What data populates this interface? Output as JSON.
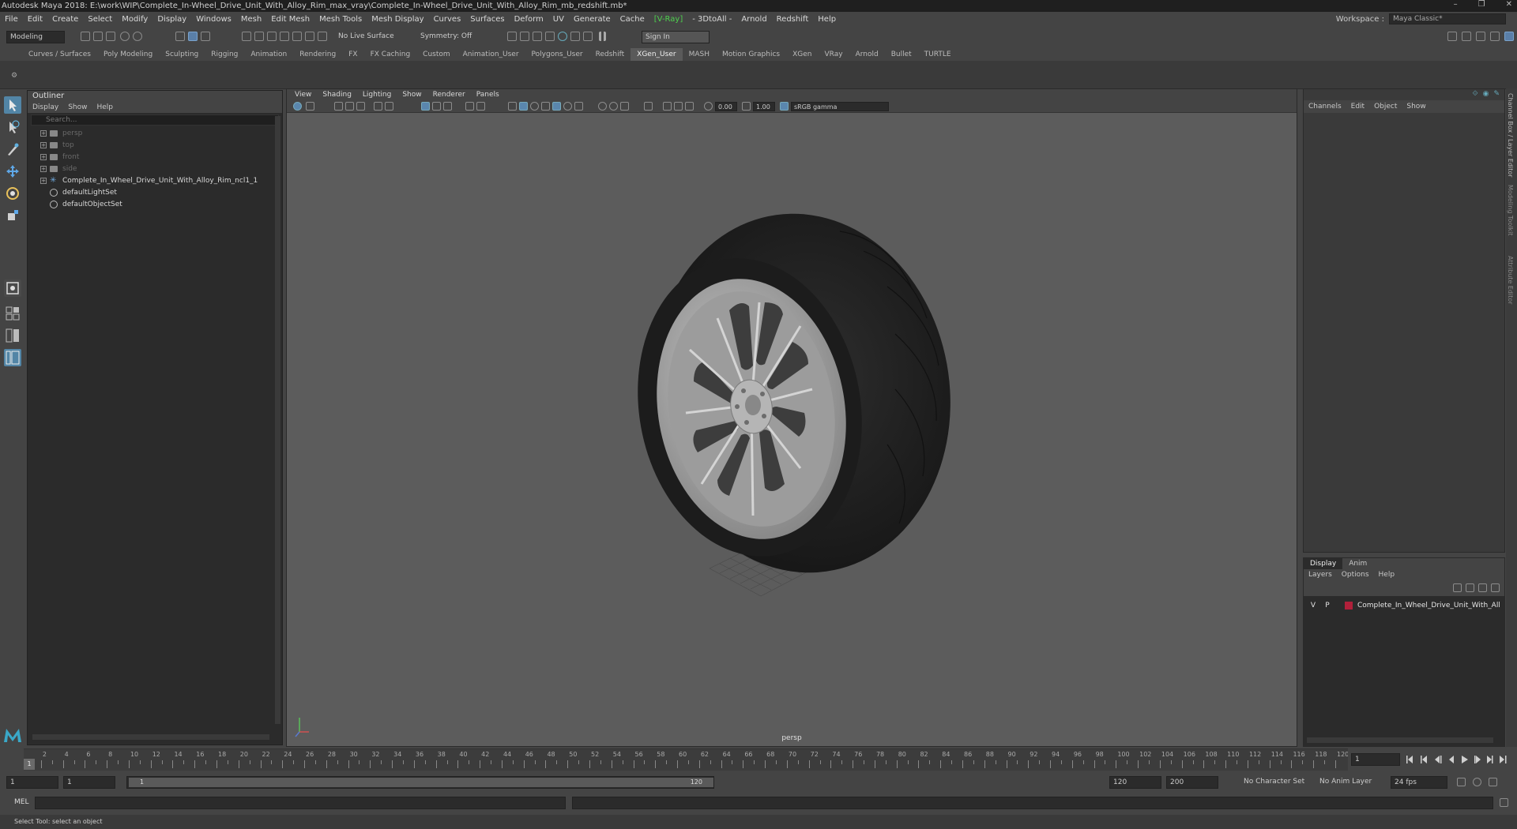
{
  "window": {
    "title": "Autodesk Maya 2018: E:\\work\\WIP\\Complete_In-Wheel_Drive_Unit_With_Alloy_Rim_max_vray\\Complete_In-Wheel_Drive_Unit_With_Alloy_Rim_mb_redshift.mb*",
    "minimize": "–",
    "restore": "❐",
    "close": "✕"
  },
  "menubar": {
    "items": [
      "File",
      "Edit",
      "Create",
      "Select",
      "Modify",
      "Display",
      "Windows",
      "Mesh",
      "Edit Mesh",
      "Mesh Tools",
      "Mesh Display",
      "Curves",
      "Surfaces",
      "Deform",
      "UV",
      "Generate",
      "Cache",
      "[V-Ray]",
      "- 3DtoAll -",
      "Arnold",
      "Redshift",
      "Help"
    ],
    "workspace_label": "Workspace :",
    "workspace_value": "Maya Classic*"
  },
  "statusline": {
    "mode": "Modeling",
    "live_surface": "No Live Surface",
    "symmetry": "Symmetry: Off",
    "sign_in": "Sign In"
  },
  "shelf": {
    "tabs": [
      "Curves / Surfaces",
      "Poly Modeling",
      "Sculpting",
      "Rigging",
      "Animation",
      "Rendering",
      "FX",
      "FX Caching",
      "Custom",
      "Animation_User",
      "Polygons_User",
      "Redshift",
      "XGen_User",
      "MASH",
      "Motion Graphics",
      "XGen",
      "VRay",
      "Arnold",
      "Bullet",
      "TURTLE"
    ],
    "active_tab": "XGen_User"
  },
  "outliner": {
    "title": "Outliner",
    "menu": [
      "Display",
      "Show",
      "Help"
    ],
    "search_placeholder": "Search...",
    "items": [
      {
        "label": "persp",
        "dim": true,
        "icon": "camera-icon"
      },
      {
        "label": "top",
        "dim": true,
        "icon": "camera-icon"
      },
      {
        "label": "front",
        "dim": true,
        "icon": "camera-icon"
      },
      {
        "label": "side",
        "dim": true,
        "icon": "camera-icon"
      },
      {
        "label": "Complete_In_Wheel_Drive_Unit_With_Alloy_Rim_ncl1_1",
        "dim": false,
        "icon": "transform-icon"
      },
      {
        "label": "defaultLightSet",
        "dim": false,
        "icon": "set-icon"
      },
      {
        "label": "defaultObjectSet",
        "dim": false,
        "icon": "set-icon"
      }
    ]
  },
  "viewport": {
    "menu": [
      "View",
      "Shading",
      "Lighting",
      "Show",
      "Renderer",
      "Panels"
    ],
    "exposure": "0.00",
    "gamma": "1.00",
    "color_space": "sRGB gamma",
    "camera": "persp"
  },
  "channelbox": {
    "menu": [
      "Channels",
      "Edit",
      "Object",
      "Show"
    ]
  },
  "layers": {
    "tabs": [
      "Display",
      "Anim"
    ],
    "active_tab": "Display",
    "menu": [
      "Layers",
      "Options",
      "Help"
    ],
    "rows": [
      {
        "v": "V",
        "p": "P",
        "name": "Complete_In_Wheel_Drive_Unit_With_Alloy_Rim",
        "color": "#b0203a"
      }
    ]
  },
  "right_tabs": [
    "Channel Box / Layer Editor",
    "Modeling Toolkit",
    "Attribute Editor"
  ],
  "timeslider": {
    "ticks": [
      "2",
      "4",
      "6",
      "8",
      "10",
      "12",
      "14",
      "16",
      "18",
      "20",
      "22",
      "24",
      "26",
      "28",
      "30",
      "32",
      "34",
      "36",
      "38",
      "40",
      "42",
      "44",
      "46",
      "48",
      "50",
      "52",
      "54",
      "56",
      "58",
      "60",
      "62",
      "64",
      "66",
      "68",
      "70",
      "72",
      "74",
      "76",
      "78",
      "80",
      "82",
      "84",
      "86",
      "88",
      "90",
      "92",
      "94",
      "96",
      "98",
      "100",
      "102",
      "104",
      "106",
      "108",
      "110",
      "112",
      "114",
      "116",
      "118",
      "120"
    ],
    "current_frame": "1",
    "current_field": "1"
  },
  "range": {
    "start": "1",
    "start_inner": "1",
    "slider_start": "1",
    "slider_end": "120",
    "end_inner": "120",
    "end": "200",
    "character_set": "No Character Set",
    "anim_layer": "No Anim Layer",
    "fps": "24 fps"
  },
  "cmdline": {
    "lang": "MEL"
  },
  "helpline": {
    "text": "Select Tool: select an object"
  }
}
